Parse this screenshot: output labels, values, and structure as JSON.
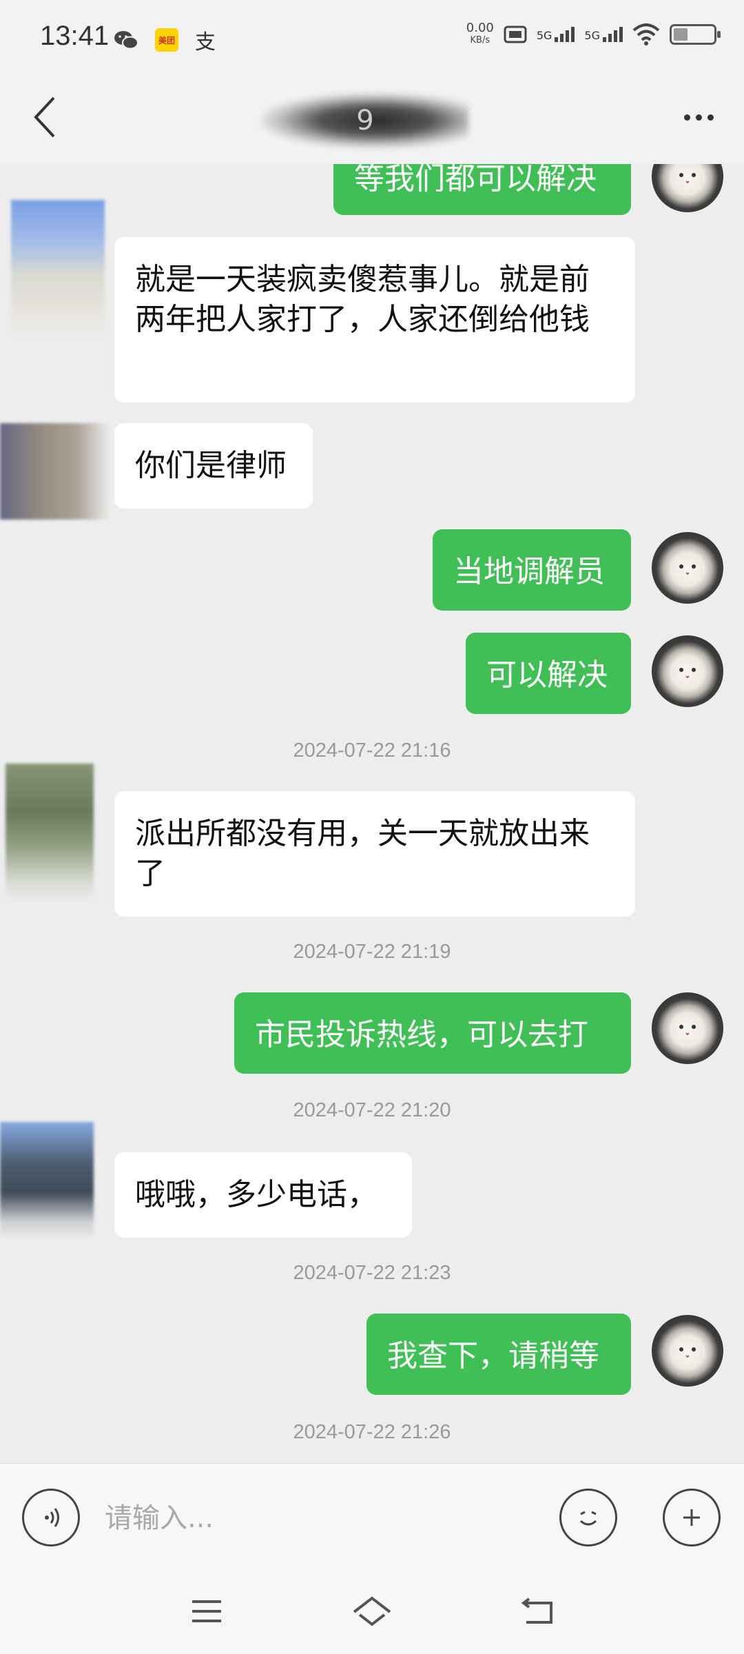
{
  "status_bar": {
    "time": "13:41",
    "net_speed_value": "0.00",
    "net_speed_unit": "KB/s",
    "sim1_label": "5G",
    "sim2_label": "5G",
    "icons": [
      "wechat-icon",
      "meituan-icon",
      "alipay-icon",
      "hd-icon",
      "signal-icon",
      "signal-icon",
      "wifi-icon",
      "battery-icon"
    ],
    "battery_level": 0.35
  },
  "header": {
    "title": "9"
  },
  "messages": [
    {
      "side": "out",
      "text": "等我们都可以解决"
    },
    {
      "side": "in",
      "text": "就是一天装疯卖傻惹事儿。就是前两年把人家打了，人家还倒给他钱"
    },
    {
      "side": "in",
      "text": "你们是律师"
    },
    {
      "side": "out",
      "text": "当地调解员"
    },
    {
      "side": "out",
      "text": "可以解决"
    },
    {
      "type": "time",
      "text": "2024-07-22 21:16"
    },
    {
      "side": "in",
      "text": "派出所都没有用，关一天就放出来了"
    },
    {
      "type": "time",
      "text": "2024-07-22 21:19"
    },
    {
      "side": "out",
      "text": "市民投诉热线，可以去打"
    },
    {
      "type": "time",
      "text": "2024-07-22 21:20"
    },
    {
      "side": "in",
      "text": "哦哦，多少电话，"
    },
    {
      "type": "time",
      "text": "2024-07-22 21:23"
    },
    {
      "side": "out",
      "text": "我查下，请稍等"
    },
    {
      "type": "time",
      "text": "2024-07-22 21:26"
    }
  ],
  "input_bar": {
    "placeholder": "请输入..."
  },
  "colors": {
    "outgoing_bubble": "#3fbf55",
    "incoming_bubble": "#ffffff",
    "background": "#ededed"
  }
}
